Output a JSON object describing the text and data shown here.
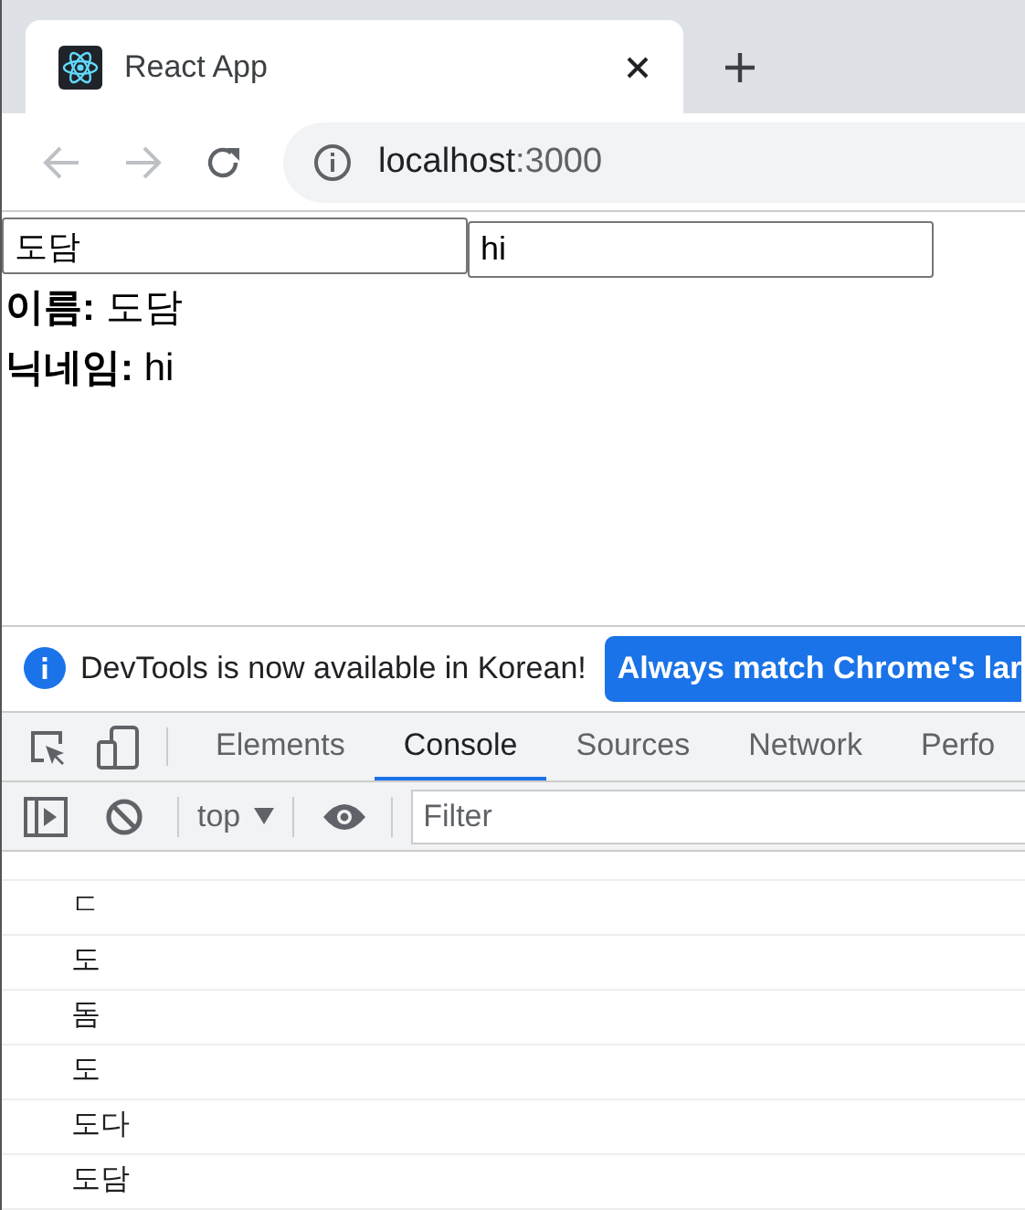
{
  "browser_tab": {
    "title": "React App"
  },
  "address_bar": {
    "host": "localhost",
    "port": ":3000"
  },
  "page": {
    "inputs": [
      {
        "value": "도담"
      },
      {
        "value": "hi"
      }
    ],
    "lines": [
      "**이름:** 도담",
      "**닉네임:** hi"
    ]
  },
  "infobar": {
    "message": "DevTools is now available in Korean!",
    "button": "Always match Chrome's lar"
  },
  "devtools_tabs": [
    {
      "label": "Elements",
      "selected": false
    },
    {
      "label": "Console",
      "selected": true
    },
    {
      "label": "Sources",
      "selected": false
    },
    {
      "label": "Network",
      "selected": false
    },
    {
      "label": "Perfo",
      "selected": false
    }
  ],
  "console_toolbar": {
    "context": "top",
    "filter_placeholder": "Filter"
  },
  "console_messages": [
    "ㄷ",
    "도",
    "돔",
    "도",
    "도다",
    "도담"
  ]
}
